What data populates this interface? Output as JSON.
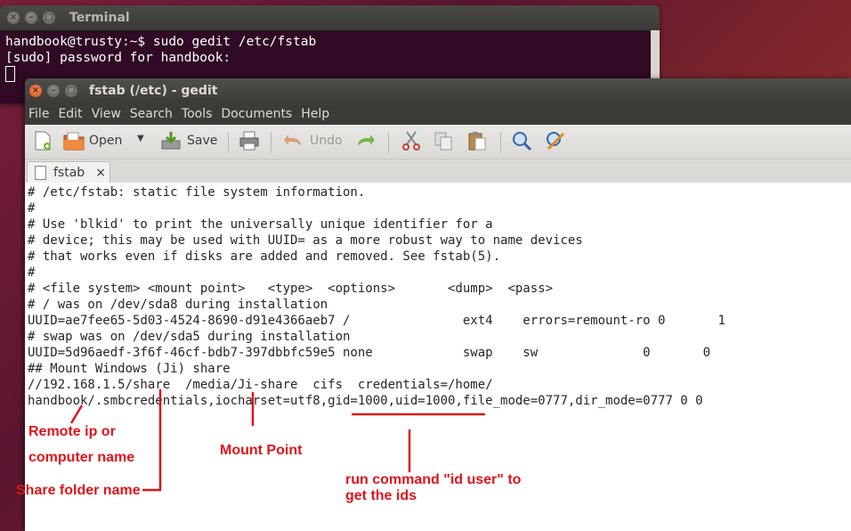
{
  "terminal": {
    "title": "Terminal",
    "lines": [
      "handbook@trusty:~$ sudo gedit /etc/fstab",
      "[sudo] password for handbook:"
    ]
  },
  "gedit": {
    "title": "fstab (/etc) - gedit",
    "menu": [
      "File",
      "Edit",
      "View",
      "Search",
      "Tools",
      "Documents",
      "Help"
    ],
    "toolbar": {
      "open_label": "Open",
      "save_label": "Save",
      "undo_label": "Undo"
    },
    "tab": {
      "label": "fstab",
      "close": "×"
    },
    "lines": [
      "# /etc/fstab: static file system information.",
      "#",
      "# Use 'blkid' to print the universally unique identifier for a",
      "# device; this may be used with UUID= as a more robust way to name devices",
      "# that works even if disks are added and removed. See fstab(5).",
      "#",
      "# <file system> <mount point>   <type>  <options>       <dump>  <pass>",
      "# / was on /dev/sda8 during installation",
      "UUID=ae7fee65-5d03-4524-8690-d91e4366aeb7 /               ext4    errors=remount-ro 0       1",
      "# swap was on /dev/sda5 during installation",
      "UUID=5d96aedf-3f6f-46cf-bdb7-397dbbfc59e5 none            swap    sw              0       0",
      "## Mount Windows (Ji) share",
      "//192.168.1.5/share  /media/Ji-share  cifs  credentials=/home/",
      "handbook/.smbcredentials,iocharset=utf8,gid=1000,uid=1000,file_mode=0777,dir_mode=0777 0 0"
    ]
  },
  "annotations": {
    "remote_ip_1": "Remote ip or",
    "remote_ip_2": "computer name",
    "share_folder": "Share folder name",
    "mount_point": "Mount Point",
    "run_cmd_1": "run command \"id user\" to",
    "run_cmd_2": "get the ids"
  },
  "colors": {
    "annotation": "#e0141a",
    "terminal_bg": "#300a24",
    "close_button": "#e0581f"
  }
}
